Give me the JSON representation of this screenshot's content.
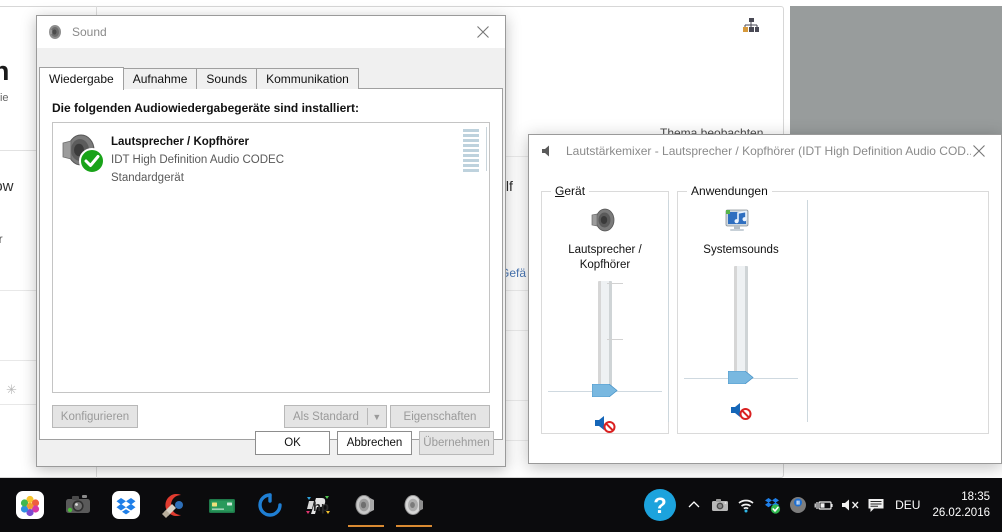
{
  "background_page": {
    "heading_fragment": "ch",
    "sub_fragment": "Die",
    "word_dow": "dow",
    "word_hr": "hr",
    "spinner_glyph": "✳",
    "hilf_fragment": "hilf",
    "thema_text": "Thema beobachten",
    "gefa_fragment": "Gefä",
    "sitemap_icon": "sitemap-icon"
  },
  "sound_dialog": {
    "title": "Sound",
    "title_icon": "speaker-icon",
    "close_icon": "close-icon",
    "tabs": [
      {
        "label": "Wiedergabe",
        "active": true
      },
      {
        "label": "Aufnahme",
        "active": false
      },
      {
        "label": "Sounds",
        "active": false
      },
      {
        "label": "Kommunikation",
        "active": false
      }
    ],
    "panel_label": "Die folgenden Audiowiedergabegeräte sind installiert:",
    "devices": [
      {
        "name": "Lautsprecher / Kopfhörer",
        "description": "IDT High Definition Audio CODEC",
        "status": "Standardgerät",
        "icon": "speaker-icon",
        "badge": "default-device-check-icon",
        "vu_bars": 9
      }
    ],
    "panel_buttons": {
      "configure": "Konfigurieren",
      "set_default": "Als Standard",
      "set_default_arrow": "▼",
      "properties": "Eigenschaften"
    },
    "dialog_buttons": {
      "ok": "OK",
      "cancel": "Abbrechen",
      "apply": "Übernehmen"
    }
  },
  "volume_mixer": {
    "title": "Lautstärkemixer - Lautsprecher / Kopfhörer (IDT High Definition Audio COD...",
    "title_icon": "speaker-icon",
    "close_icon": "close-icon",
    "groups": {
      "device": {
        "title_first": "G",
        "title_rest": "erät"
      },
      "applications": {
        "title_first": "A",
        "title_rest": "nwendungen"
      }
    },
    "device_channel": {
      "label": "Lautsprecher / Kopfhörer",
      "icon": "speaker-icon",
      "volume_percent": 0,
      "muted": true,
      "mute_icon": "mute-speaker-icon"
    },
    "app_channels": [
      {
        "label": "Systemsounds",
        "icon": "system-sounds-icon",
        "volume_percent": 0,
        "muted": true,
        "mute_icon": "mute-speaker-icon"
      }
    ]
  },
  "taskbar": {
    "apps": [
      {
        "name": "photos-app-icon",
        "running": false
      },
      {
        "name": "camera-app-icon",
        "running": false
      },
      {
        "name": "dropbox-app-icon",
        "running": false
      },
      {
        "name": "ccleaner-app-icon",
        "running": false
      },
      {
        "name": "wallet-app-icon",
        "running": false
      },
      {
        "name": "spinner-app-icon",
        "running": false
      },
      {
        "name": "hp-app-icon",
        "running": false
      },
      {
        "name": "sound-app-icon",
        "running": true
      },
      {
        "name": "sound-mixer-app-icon",
        "running": true
      }
    ],
    "tray": {
      "help_icon": "help-circle-icon",
      "chevron_icon": "chevron-up-icon",
      "camera_icon": "camera-tray-icon",
      "wifi_icon": "wifi-icon",
      "dropbox_icon": "dropbox-tray-icon",
      "pause_icon": "pause-circle-icon",
      "battery_icon": "battery-charging-icon",
      "volume_icon": "volume-muted-icon",
      "notification_icon": "action-center-icon",
      "language": "DEU"
    },
    "clock": {
      "time": "18:35",
      "date": "26.02.2016"
    }
  }
}
